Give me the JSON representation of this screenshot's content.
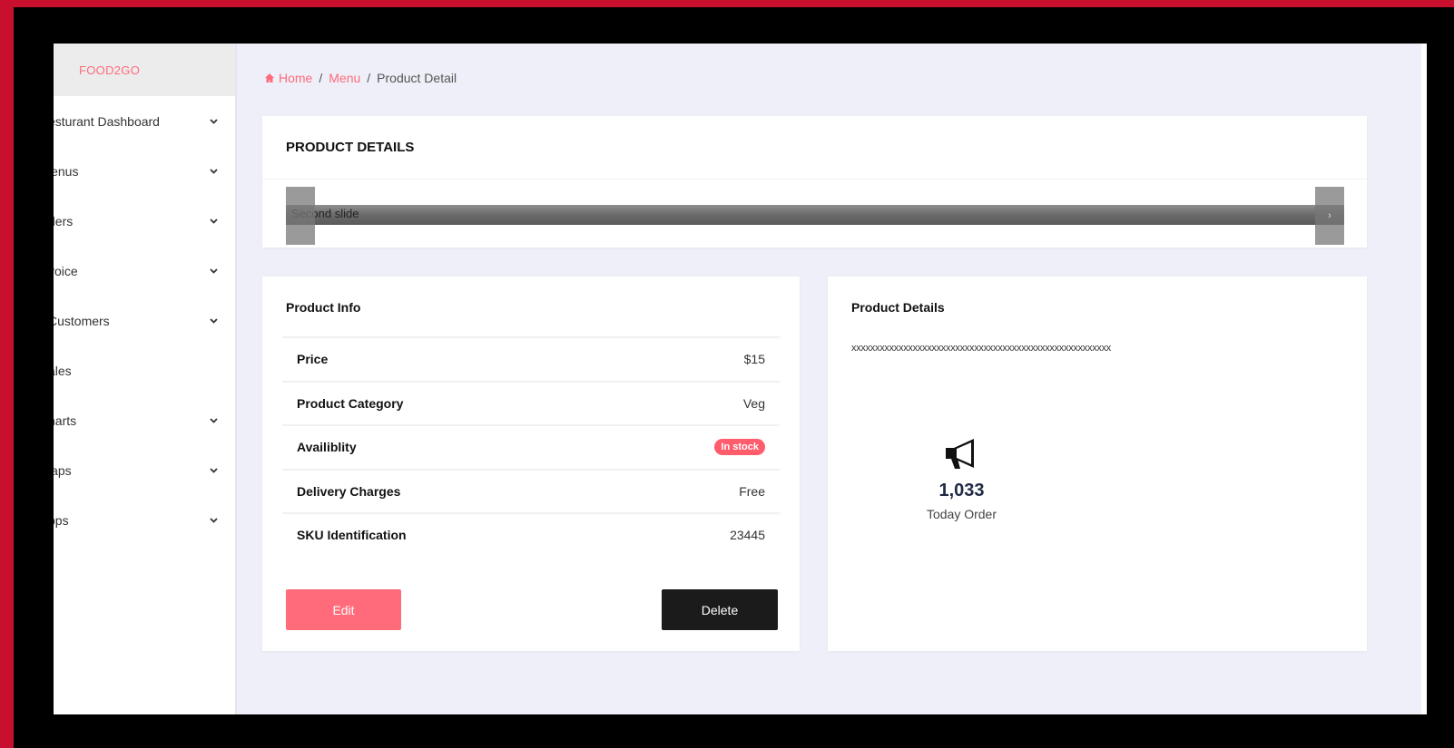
{
  "colors": {
    "frame_border": "#c8102e",
    "accent": "#ff6b7a",
    "badge_bg": "#ff5c6c",
    "delete_bg": "#1b1b1b",
    "page_bg": "#eeeff8"
  },
  "sidebar": {
    "brand": "FOOD2GO",
    "items": [
      {
        "label": "esturant Dashboard",
        "has_chevron": true
      },
      {
        "label": "lenus",
        "has_chevron": true
      },
      {
        "label": "ders",
        "has_chevron": true
      },
      {
        "label": "voice",
        "has_chevron": true
      },
      {
        "label": "Customers",
        "has_chevron": true
      },
      {
        "label": "ales",
        "has_chevron": false
      },
      {
        "label": "harts",
        "has_chevron": true
      },
      {
        "label": "laps",
        "has_chevron": true
      },
      {
        "label": "pps",
        "has_chevron": true
      }
    ]
  },
  "breadcrumb": {
    "home": "Home",
    "sep1": "/",
    "menu": "Menu",
    "sep2": "/",
    "current": "Product Detail"
  },
  "top_card": {
    "title": "PRODUCT DETAILS",
    "carousel_alt": "Second slide",
    "next_glyph": "›"
  },
  "product_info": {
    "title": "Product Info",
    "rows": [
      {
        "key": "Price",
        "value": "$15"
      },
      {
        "key": "Product Category",
        "value": "Veg"
      },
      {
        "key": "Availiblity",
        "value": "In stock"
      },
      {
        "key": "Delivery Charges",
        "value": "Free"
      },
      {
        "key": "SKU Identification",
        "value": "23445"
      }
    ],
    "edit_label": "Edit",
    "delete_label": "Delete"
  },
  "product_details": {
    "title": "Product Details",
    "description": "xxxxxxxxxxxxxxxxxxxxxxxxxxxxxxxxxxxxxxxxxxxxxxxxxxxxxxx",
    "stat_icon": "megaphone-icon",
    "stat_value": "1,033",
    "stat_label": "Today Order"
  }
}
